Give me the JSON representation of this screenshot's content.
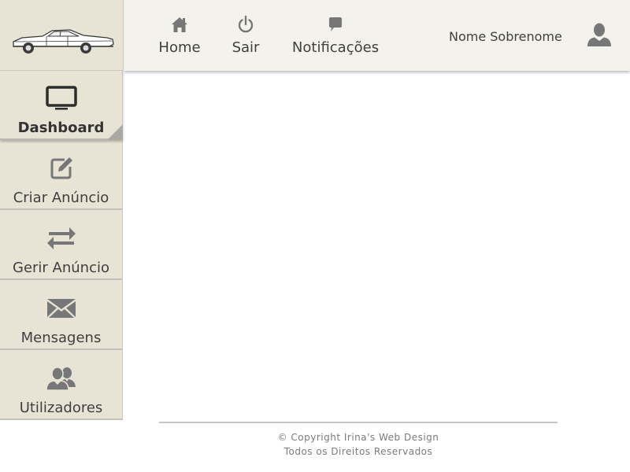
{
  "header": {
    "nav": [
      {
        "label": "Home",
        "icon": "home-icon"
      },
      {
        "label": "Sair",
        "icon": "power-icon"
      },
      {
        "label": "Notificações",
        "icon": "chat-bubble-icon"
      }
    ],
    "user_name": "Nome Sobrenome",
    "user_icon": "user-icon"
  },
  "logo": {
    "icon": "classic-car-icon"
  },
  "sidebar": {
    "items": [
      {
        "label": "Dashboard",
        "icon": "monitor-icon",
        "active": true
      },
      {
        "label": "Criar Anúncio",
        "icon": "edit-icon",
        "active": false
      },
      {
        "label": "Gerir Anúncio",
        "icon": "swap-arrows-icon",
        "active": false
      },
      {
        "label": "Mensagens",
        "icon": "envelope-icon",
        "active": false
      },
      {
        "label": "Utilizadores",
        "icon": "users-icon",
        "active": false
      }
    ]
  },
  "footer": {
    "copyright": "© Copyright Irina's Web Design",
    "rights": "Todos os Direitos Reservados"
  },
  "colors": {
    "header_bg": "#f4f2ec",
    "sidebar_bg": "#e7e4d6",
    "icon_gray": "#777777",
    "text_dark": "#3f3f3f"
  }
}
